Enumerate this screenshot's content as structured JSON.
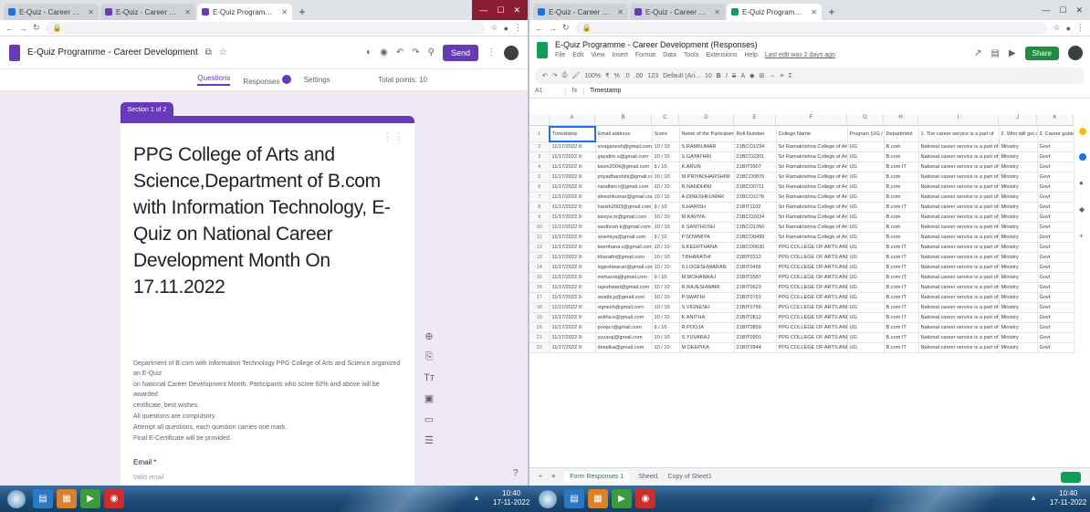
{
  "left_window": {
    "tabs": [
      {
        "label": "E-Quiz - Career Development"
      },
      {
        "label": "E-Quiz - Career Development"
      },
      {
        "label": "E-Quiz Programme - Career Dev"
      }
    ],
    "form": {
      "doc_title": "E-Quiz Programme - Career Development",
      "send_label": "Send",
      "tabs": [
        "Questions",
        "Responses",
        "Settings"
      ],
      "total_points": "Total points: 10",
      "section_label": "Section 1 of 2",
      "title": "PPG College of Arts and Science,Department of B.com with Information Technology, E-Quiz on National Career Development Month On 17.11.2022",
      "description": [
        "Department of B.com with Information Technology PPG College of Arts and Science organized an E-Quiz",
        "on National Career Development Month. Participants who score 60% and above will be awarded",
        "certificate, best wishes.",
        "All questions are compulsory.",
        "Attempt all questions, each question carries one mark.",
        "Final E-Certificate will be provided."
      ],
      "question": "Email *",
      "question_hint": "Valid email"
    }
  },
  "right_window": {
    "tabs": [
      {
        "label": "E-Quiz - Career Development"
      },
      {
        "label": "E-Quiz - Career Development"
      },
      {
        "label": "E-Quiz Programme - Career Dev"
      }
    ],
    "sheet": {
      "title": "E-Quiz Programme - Career Development (Responses)",
      "menu": [
        "File",
        "Edit",
        "View",
        "Insert",
        "Format",
        "Data",
        "Tools",
        "Extensions",
        "Help"
      ],
      "last_edit": "Last edit was 2 days ago",
      "share_label": "Share",
      "toolbar": [
        "100%",
        "₹",
        "%",
        ".0",
        ".00",
        "123",
        "Default (Ari...",
        "10",
        "B",
        "I",
        "S",
        "A"
      ],
      "name_box": "A1",
      "formula": "Timestamp",
      "columns": [
        "A",
        "B",
        "C",
        "D",
        "E",
        "F",
        "G",
        "H",
        "I",
        "J",
        "K"
      ],
      "headers": [
        "Timestamp",
        "Email address",
        "Score",
        "Name of the Participant",
        "Roll Number",
        "College Name",
        "Program (UG / PG)",
        "Department",
        "1. The career service is a part of",
        "2. Who will get a",
        "3. Career guidance"
      ],
      "rows": [
        [
          "11/17/2022 9:",
          "sivaganesh@gmail.com",
          "10 / 10",
          "S.RAMKUMAR",
          "21BCO1234",
          "Sri Ramakrishna College of Arts",
          "UG",
          "B.com",
          "National career service is a part of",
          "Ministry",
          "Govt"
        ],
        [
          "11/17/2022 9:",
          "gayathri.s@gmail.com",
          "10 / 10",
          "S.GAYATHRI",
          "21BCO2201",
          "Sri Ramakrishna College of Arts",
          "UG",
          "B.com",
          "National career service is a part of",
          "Ministry",
          "Govt"
        ],
        [
          "11/17/2022 9:",
          "kavin2004@gmail.com",
          "9 / 10",
          "K.ARUN",
          "21BIT0907",
          "Sri Ramakrishna College of Arts",
          "UG",
          "B.com IT",
          "National career service is a part of",
          "Ministry",
          "Govt"
        ],
        [
          "11/17/2022 9:",
          "priyadharshini@gmail.com",
          "10 / 10",
          "M.PRIYADHARSHINI",
          "21BCO0876",
          "Sri Ramakrishna College of Arts",
          "UG",
          "B.com",
          "National career service is a part of",
          "Ministry",
          "Govt"
        ],
        [
          "11/17/2022 9:",
          "nandhini.r@gmail.com",
          "10 / 10",
          "R.NANDHINI",
          "21BCO0711",
          "Sri Ramakrishna College of Arts",
          "UG",
          "B.com",
          "National career service is a part of",
          "Ministry",
          "Govt"
        ],
        [
          "11/17/2022 9:",
          "dineshkumar@gmail.com",
          "10 / 10",
          "A.DINESHKUMAR",
          "21BCO1178",
          "Sri Ramakrishna College of Arts",
          "UG",
          "B.com",
          "National career service is a part of",
          "Ministry",
          "Govt"
        ],
        [
          "11/17/2022 9:",
          "harish2003@gmail.com",
          "9 / 10",
          "S.HARISH",
          "21BIT1102",
          "Sri Ramakrishna College of Arts",
          "UG",
          "B.com IT",
          "National career service is a part of",
          "Ministry",
          "Govt"
        ],
        [
          "11/17/2022 9:",
          "kaviya.m@gmail.com",
          "10 / 10",
          "M.KAVIYA",
          "21BCO2034",
          "Sri Ramakrishna College of Arts",
          "UG",
          "B.com",
          "National career service is a part of",
          "Ministry",
          "Govt"
        ],
        [
          "11/17/2022 9:",
          "santhosh.k@gmail.com",
          "10 / 10",
          "K.SANTHOSH",
          "21BCO1356",
          "Sri Ramakrishna College of Arts",
          "UG",
          "B.com",
          "National career service is a part of",
          "Ministry",
          "Govt"
        ],
        [
          "11/17/2022 9:",
          "sowmiya@gmail.com",
          "9 / 10",
          "P.SOWMIYA",
          "21BCO0499",
          "Sri Ramakrishna College of Arts",
          "UG",
          "B.com",
          "National career service is a part of",
          "Ministry",
          "Govt"
        ],
        [
          "11/17/2022 9:",
          "keerthana.s@gmail.com",
          "10 / 10",
          "S.KEERTHANA",
          "21BCO0630",
          "PPG COLLEGE OF ARTS AND SCIENCE",
          "UG",
          "B.com IT",
          "National career service is a part of",
          "Ministry",
          "Govt"
        ],
        [
          "11/17/2022 9:",
          "bharathi@gmail.com",
          "10 / 10",
          "T.BHARATHI",
          "21BIT0312",
          "PPG COLLEGE OF ARTS AND SCIENCE",
          "UG",
          "B.com IT",
          "National career service is a part of",
          "Ministry",
          "Govt"
        ],
        [
          "11/17/2022 9:",
          "logeshwaran@gmail.com",
          "10 / 10",
          "S.LOGESHWARAN",
          "21BIT0455",
          "PPG COLLEGE OF ARTS AND SCIENCE",
          "UG",
          "B.com IT",
          "National career service is a part of",
          "Ministry",
          "Govt"
        ],
        [
          "11/17/2022 9:",
          "mohanraj@gmail.com",
          "9 / 10",
          "M.MOHANRAJ",
          "21BIT0587",
          "PPG COLLEGE OF ARTS AND SCIENCE",
          "UG",
          "B.com IT",
          "National career service is a part of",
          "Ministry",
          "Govt"
        ],
        [
          "11/17/2022 9:",
          "rajeshwari@gmail.com",
          "10 / 10",
          "R.RAJESHWARI",
          "21BIT0623",
          "PPG COLLEGE OF ARTS AND SCIENCE",
          "UG",
          "B.com IT",
          "National career service is a part of",
          "Ministry",
          "Govt"
        ],
        [
          "11/17/2022 9:",
          "swathi.p@gmail.com",
          "10 / 10",
          "P.SWATHI",
          "21BIT0701",
          "PPG COLLEGE OF ARTS AND SCIENCE",
          "UG",
          "B.com IT",
          "National career service is a part of",
          "Ministry",
          "Govt"
        ],
        [
          "11/17/2022 9:",
          "vignesh@gmail.com",
          "10 / 10",
          "S.VIGNESH",
          "21BIT0766",
          "PPG COLLEGE OF ARTS AND SCIENCE",
          "UG",
          "B.com IT",
          "National career service is a part of",
          "Ministry",
          "Govt"
        ],
        [
          "11/17/2022 9:",
          "anitha.k@gmail.com",
          "10 / 10",
          "K.ANITHA",
          "21BIT0812",
          "PPG COLLEGE OF ARTS AND SCIENCE",
          "UG",
          "B.com IT",
          "National career service is a part of",
          "Ministry",
          "Govt"
        ],
        [
          "11/17/2022 9:",
          "pooja.r@gmail.com",
          "9 / 10",
          "R.POOJA",
          "21BIT0859",
          "PPG COLLEGE OF ARTS AND SCIENCE",
          "UG",
          "B.com IT",
          "National career service is a part of",
          "Ministry",
          "Govt"
        ],
        [
          "11/17/2022 9:",
          "yuvaraj@gmail.com",
          "10 / 10",
          "S.YUVARAJ",
          "21BIT0901",
          "PPG COLLEGE OF ARTS AND SCIENCE",
          "UG",
          "B.com IT",
          "National career service is a part of",
          "Ministry",
          "Govt"
        ],
        [
          "11/17/2022 9:",
          "deepika@gmail.com",
          "10 / 10",
          "M.DEEPIKA",
          "21BIT0944",
          "PPG COLLEGE OF ARTS AND SCIENCE",
          "UG",
          "B.com IT",
          "National career service is a part of",
          "Ministry",
          "Govt"
        ]
      ],
      "sheet_tabs": [
        "Form Responses 1",
        "Sheet1",
        "Copy of Sheet1"
      ]
    }
  },
  "taskbar": {
    "clock_left_time": "10:40",
    "clock_left_date": "17-11-2022",
    "clock_right_time": "10:40",
    "clock_right_date": "17-11-2022"
  },
  "colors": {
    "forms_purple": "#673ab7",
    "sheets_green": "#0f9d58",
    "taskbar_blue": "#1c4b78"
  }
}
